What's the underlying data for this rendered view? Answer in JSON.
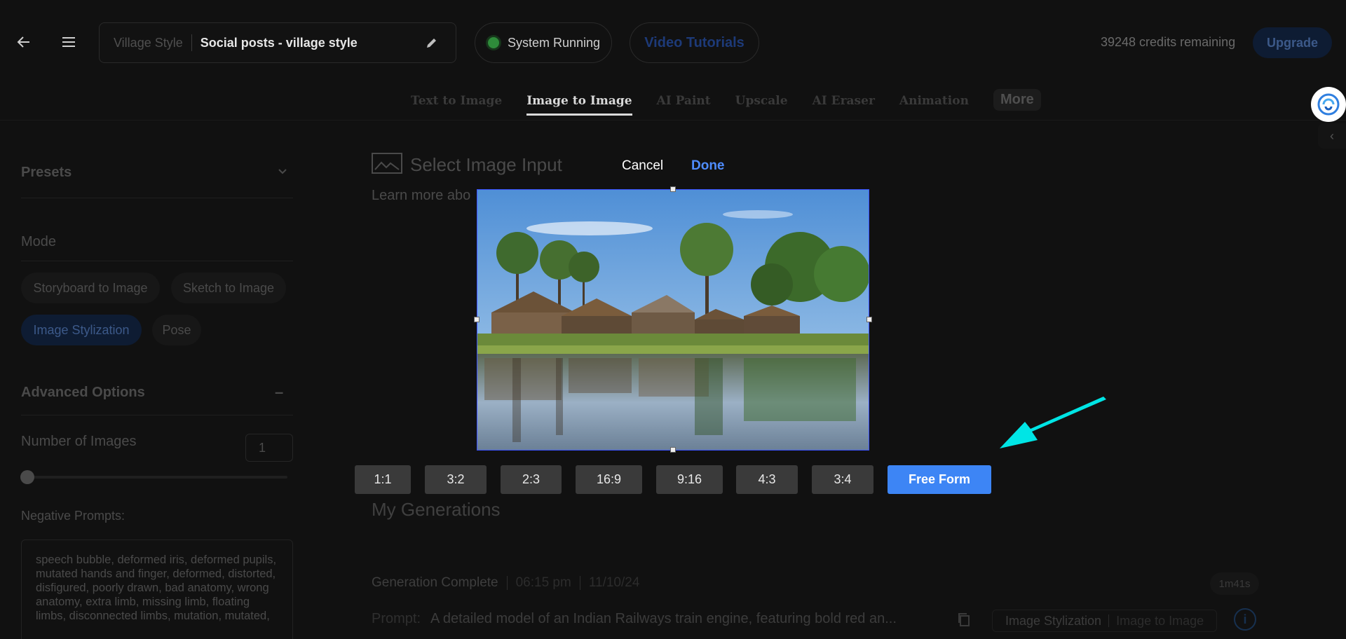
{
  "header": {
    "project_prefix": "Village Style",
    "project_name": "Social posts - village style",
    "status": "System Running",
    "video_tutorials": "Video Tutorials",
    "credits": "39248 credits remaining",
    "upgrade": "Upgrade"
  },
  "tabs": {
    "items": [
      "Text to Image",
      "Image to Image",
      "AI Paint",
      "Upscale",
      "AI Eraser",
      "Animation"
    ],
    "active_index": 1,
    "more": "More"
  },
  "sidebar": {
    "presets": "Presets",
    "mode": "Mode",
    "mode_options": [
      "Storyboard to Image",
      "Sketch to Image",
      "Image Stylization",
      "Pose"
    ],
    "mode_active": "Image Stylization",
    "advanced": "Advanced Options",
    "advanced_toggle": "–",
    "num_images_label": "Number of Images",
    "num_images_value": "1",
    "neg_label": "Negative Prompts:",
    "neg_text": "speech bubble, deformed iris, deformed pupils, mutated hands and finger, deformed, distorted, disfigured, poorly drawn, bad anatomy, wrong anatomy, extra limb, missing limb, floating limbs, disconnected limbs, mutation, mutated,"
  },
  "main": {
    "select_title": "Select Image Input",
    "learn_more": "Learn more abo",
    "my_generations": "My Generations",
    "gen_status": "Generation Complete",
    "gen_time": "06:15 pm",
    "gen_date": "11/10/24",
    "gen_duration": "1m41s",
    "prompt_label": "Prompt:",
    "prompt_text": "A detailed model of an Indian Railways train engine, featuring bold red an...",
    "tag_mode": "Image Stylization",
    "tag_type": "Image to Image"
  },
  "modal": {
    "cancel": "Cancel",
    "done": "Done",
    "ratios": [
      "1:1",
      "3:2",
      "2:3",
      "16:9",
      "9:16",
      "4:3",
      "3:4",
      "Free Form"
    ],
    "active_ratio": "Free Form"
  },
  "colors": {
    "accent": "#3d85f5",
    "done": "#4f8dff",
    "annotation_arrow": "#00e5e5",
    "crop_border": "#3b52ff"
  },
  "icons": [
    "back-arrow-icon",
    "hamburger-menu-icon",
    "pencil-icon",
    "status-dot-icon",
    "image-input-icon",
    "copy-icon",
    "info-icon",
    "collapse-chevron-icon",
    "chevron-down-icon",
    "app-logo-icon"
  ]
}
